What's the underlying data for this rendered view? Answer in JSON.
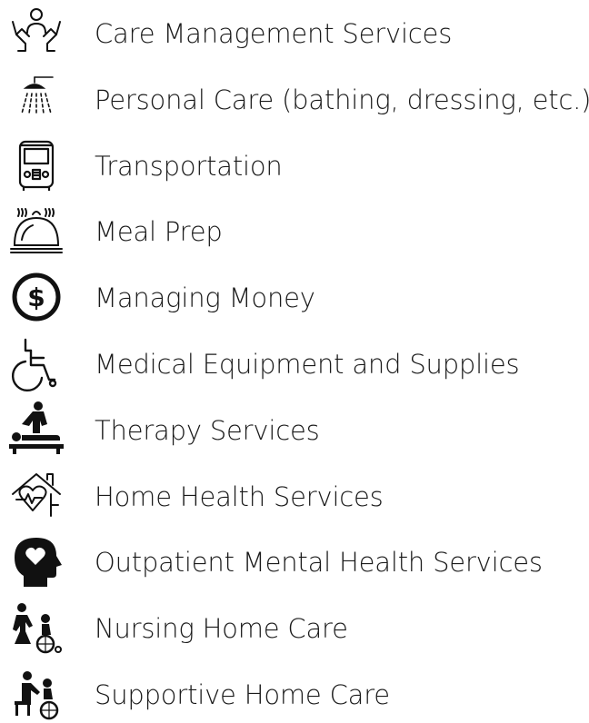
{
  "services": [
    {
      "label": "Care Management Services",
      "icon": "care-hands-icon"
    },
    {
      "label": "Personal Care (bathing, dressing, etc.)",
      "icon": "shower-icon"
    },
    {
      "label": "Transportation",
      "icon": "bus-icon"
    },
    {
      "label": "Meal Prep",
      "icon": "serving-cloche-icon"
    },
    {
      "label": "Managing Money",
      "icon": "dollar-coin-icon"
    },
    {
      "label": "Medical Equipment and Supplies",
      "icon": "wheelchair-icon"
    },
    {
      "label": "Therapy Services",
      "icon": "massage-therapy-icon"
    },
    {
      "label": "Home Health Services",
      "icon": "house-heartbeat-icon"
    },
    {
      "label": "Outpatient Mental Health Services",
      "icon": "head-heart-icon"
    },
    {
      "label": "Nursing Home Care",
      "icon": "caregiver-wheelchair-icon"
    },
    {
      "label": "Supportive Home Care",
      "icon": "caregiver-assist-icon"
    }
  ]
}
